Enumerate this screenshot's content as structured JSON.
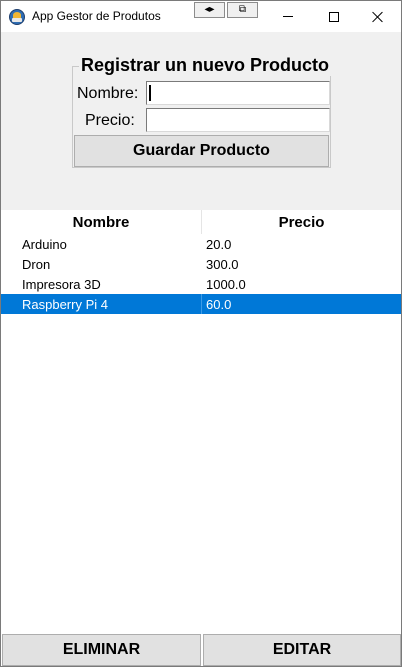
{
  "window": {
    "title": "App Gestor de Produtos"
  },
  "form": {
    "legend": "Registrar un nuevo Producto",
    "nombre_label": "Nombre:",
    "nombre_value": "",
    "precio_label": "Precio:",
    "precio_value": "",
    "save_label": "Guardar Producto"
  },
  "table": {
    "columns": [
      "Nombre",
      "Precio"
    ],
    "rows": [
      {
        "nombre": "Arduino",
        "precio": "20.0",
        "selected": false
      },
      {
        "nombre": "Dron",
        "precio": "300.0",
        "selected": false
      },
      {
        "nombre": "Impresora 3D",
        "precio": "1000.0",
        "selected": false
      },
      {
        "nombre": "Raspberry Pi 4",
        "precio": "60.0",
        "selected": true
      }
    ]
  },
  "actions": {
    "delete_label": "ELIMINAR",
    "edit_label": "EDITAR"
  },
  "colors": {
    "selection": "#0078d7",
    "form_background": "#f0f0f0",
    "button_face": "#e1e1e1"
  }
}
